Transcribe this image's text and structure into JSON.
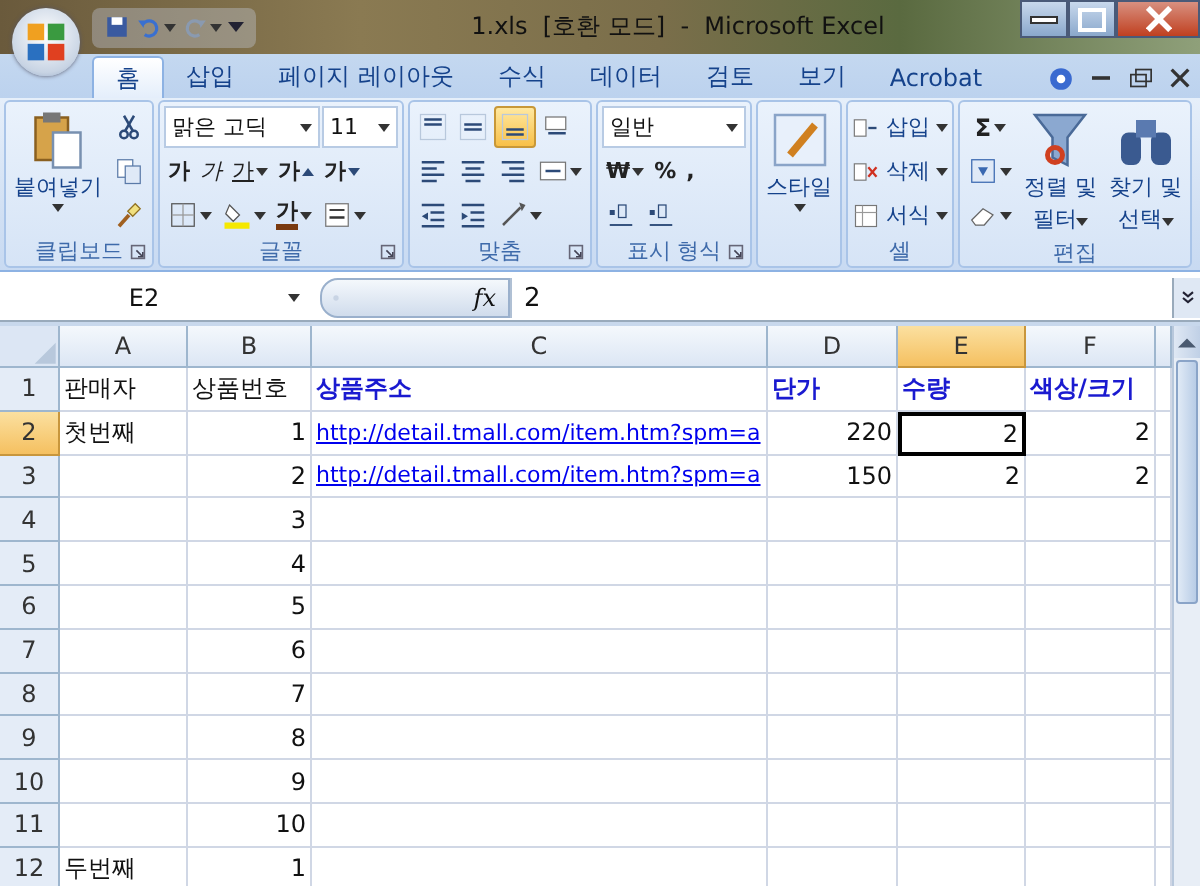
{
  "window": {
    "title": "1.xls  [호환 모드]  -  Microsoft Excel"
  },
  "tabs": [
    {
      "label": "홈",
      "selected": true
    },
    {
      "label": "삽입",
      "selected": false
    },
    {
      "label": "페이지 레이아웃",
      "selected": false
    },
    {
      "label": "수식",
      "selected": false
    },
    {
      "label": "데이터",
      "selected": false
    },
    {
      "label": "검토",
      "selected": false
    },
    {
      "label": "보기",
      "selected": false
    },
    {
      "label": "Acrobat",
      "selected": false
    }
  ],
  "ribbon": {
    "groups": [
      {
        "label": "클립보드",
        "launcher": true,
        "items": [
          {
            "kind": "large",
            "label": "붙여넣기",
            "dropdown": true
          },
          {
            "kind": "stack",
            "items": [
              {
                "kind": "icon"
              },
              {
                "kind": "icon"
              },
              {
                "kind": "icon"
              }
            ]
          }
        ]
      },
      {
        "label": "글꼴",
        "launcher": true,
        "items": [
          {
            "kind": "stack",
            "items": [
              {
                "kind": "row",
                "items": [
                  {
                    "kind": "combo",
                    "value": "맑은 고딕"
                  },
                  {
                    "kind": "combo",
                    "value": "11"
                  }
                ]
              },
              {
                "kind": "row",
                "items": [
                  {
                    "kind": "glyph",
                    "label": "가"
                  },
                  {
                    "kind": "glyph",
                    "label": "가"
                  },
                  {
                    "kind": "glyph",
                    "label": "가",
                    "dropdown": true
                  },
                  {
                    "kind": "glyph",
                    "label": "가"
                  },
                  {
                    "kind": "glyph",
                    "label": "가"
                  }
                ]
              },
              {
                "kind": "row",
                "items": [
                  {
                    "kind": "icon",
                    "dropdown": true
                  },
                  {
                    "kind": "icon",
                    "dropdown": true
                  },
                  {
                    "kind": "glyph",
                    "label": "가",
                    "dropdown": true
                  },
                  {
                    "kind": "icon",
                    "dropdown": true
                  }
                ]
              }
            ]
          }
        ]
      },
      {
        "label": "맞춤",
        "launcher": true,
        "items": [
          {
            "kind": "stack",
            "items": [
              {
                "kind": "row",
                "items": [
                  {
                    "kind": "icon",
                    "selected": false
                  },
                  {
                    "kind": "icon",
                    "selected": false
                  },
                  {
                    "kind": "icon",
                    "selected": true
                  },
                  {
                    "kind": "icon"
                  }
                ]
              },
              {
                "kind": "row",
                "items": [
                  {
                    "kind": "icon"
                  },
                  {
                    "kind": "icon"
                  },
                  {
                    "kind": "icon"
                  },
                  {
                    "kind": "icon",
                    "dropdown": true
                  }
                ]
              },
              {
                "kind": "row",
                "items": [
                  {
                    "kind": "icon"
                  },
                  {
                    "kind": "icon"
                  },
                  {
                    "kind": "icon",
                    "dropdown": true
                  }
                ]
              }
            ]
          }
        ]
      },
      {
        "label": "표시 형식",
        "launcher": true,
        "items": [
          {
            "kind": "stack",
            "items": [
              {
                "kind": "row",
                "items": [
                  {
                    "kind": "combo",
                    "value": "일반"
                  }
                ]
              },
              {
                "kind": "row",
                "items": [
                  {
                    "kind": "glyph",
                    "label": "₩",
                    "dropdown": true
                  },
                  {
                    "kind": "glyph",
                    "label": "%"
                  },
                  {
                    "kind": "glyph",
                    "label": ","
                  }
                ]
              },
              {
                "kind": "row",
                "items": [
                  {
                    "kind": "icon"
                  },
                  {
                    "kind": "icon"
                  }
                ]
              }
            ]
          }
        ]
      },
      {
        "launcher": false,
        "items": [
          {
            "kind": "large",
            "label": "스타일",
            "dropdown": true
          }
        ]
      },
      {
        "label": "셀",
        "launcher": false,
        "items": [
          {
            "kind": "stack",
            "items": [
              {
                "kind": "labeled",
                "label": "삽입",
                "dropdown": true
              },
              {
                "kind": "labeled",
                "label": "삭제",
                "dropdown": true
              },
              {
                "kind": "labeled",
                "label": "서식",
                "dropdown": true
              }
            ]
          }
        ]
      },
      {
        "label": "편집",
        "launcher": false,
        "items": [
          {
            "kind": "stack",
            "items": [
              {
                "kind": "glyph",
                "label": "Σ",
                "dropdown": true
              },
              {
                "kind": "icon",
                "dropdown": true
              },
              {
                "kind": "icon",
                "dropdown": true
              }
            ]
          },
          {
            "kind": "large",
            "label": "정렬 및",
            "label2": "필터",
            "dropdown": true
          },
          {
            "kind": "large",
            "label": "찾기 및",
            "label2": "선택",
            "dropdown": true
          }
        ]
      }
    ]
  },
  "formula_bar": {
    "name_box": "E2",
    "function_label": "fx",
    "formula": "2"
  },
  "sheet": {
    "columns": [
      {
        "label": "A",
        "selected": false
      },
      {
        "label": "B",
        "selected": false
      },
      {
        "label": "C",
        "selected": false
      },
      {
        "label": "D",
        "selected": false
      },
      {
        "label": "E",
        "selected": true
      },
      {
        "label": "F",
        "selected": false
      }
    ],
    "rows": [
      {
        "header": "1",
        "selected": false,
        "cells": [
          {
            "text": "판매자",
            "kind": "text",
            "selected": false
          },
          {
            "text": "상품번호",
            "kind": "text",
            "selected": false
          },
          {
            "text": "상품주소",
            "kind": "heading",
            "selected": false
          },
          {
            "text": "단가",
            "kind": "heading",
            "selected": false
          },
          {
            "text": "수량",
            "kind": "heading",
            "selected": false
          },
          {
            "text": "색상/크기",
            "kind": "heading",
            "selected": false
          }
        ]
      },
      {
        "header": "2",
        "selected": true,
        "cells": [
          {
            "text": "첫번째",
            "kind": "text",
            "selected": false
          },
          {
            "text": "1",
            "kind": "number",
            "selected": false
          },
          {
            "text": "http://detail.tmall.com/item.htm?spm=a",
            "kind": "link",
            "selected": false
          },
          {
            "text": "220",
            "kind": "number",
            "selected": false
          },
          {
            "text": "2",
            "kind": "number",
            "selected": true
          },
          {
            "text": "2",
            "kind": "number",
            "selected": false
          }
        ]
      },
      {
        "header": "3",
        "selected": false,
        "cells": [
          null,
          {
            "text": "2",
            "kind": "number",
            "selected": false
          },
          {
            "text": "http://detail.tmall.com/item.htm?spm=a",
            "kind": "link",
            "selected": false
          },
          {
            "text": "150",
            "kind": "number",
            "selected": false
          },
          {
            "text": "2",
            "kind": "number",
            "selected": false
          },
          {
            "text": "2",
            "kind": "number",
            "selected": false
          }
        ]
      },
      {
        "header": "4",
        "selected": false,
        "cells": [
          null,
          {
            "text": "3",
            "kind": "number",
            "selected": false
          },
          null,
          null,
          null,
          null
        ]
      },
      {
        "header": "5",
        "selected": false,
        "cells": [
          null,
          {
            "text": "4",
            "kind": "number",
            "selected": false
          },
          null,
          null,
          null,
          null
        ]
      },
      {
        "header": "6",
        "selected": false,
        "cells": [
          null,
          {
            "text": "5",
            "kind": "number",
            "selected": false
          },
          null,
          null,
          null,
          null
        ]
      },
      {
        "header": "7",
        "selected": false,
        "cells": [
          null,
          {
            "text": "6",
            "kind": "number",
            "selected": false
          },
          null,
          null,
          null,
          null
        ]
      },
      {
        "header": "8",
        "selected": false,
        "cells": [
          null,
          {
            "text": "7",
            "kind": "number",
            "selected": false
          },
          null,
          null,
          null,
          null
        ]
      },
      {
        "header": "9",
        "selected": false,
        "cells": [
          null,
          {
            "text": "8",
            "kind": "number",
            "selected": false
          },
          null,
          null,
          null,
          null
        ]
      },
      {
        "header": "10",
        "selected": false,
        "cells": [
          null,
          {
            "text": "9",
            "kind": "number",
            "selected": false
          },
          null,
          null,
          null,
          null
        ]
      },
      {
        "header": "11",
        "selected": false,
        "cells": [
          null,
          {
            "text": "10",
            "kind": "number",
            "selected": false
          },
          null,
          null,
          null,
          null
        ]
      },
      {
        "header": "12",
        "selected": false,
        "cells": [
          {
            "text": "두번째",
            "kind": "text",
            "selected": false
          },
          {
            "text": "1",
            "kind": "number",
            "selected": false
          },
          null,
          null,
          null,
          null
        ]
      }
    ]
  }
}
